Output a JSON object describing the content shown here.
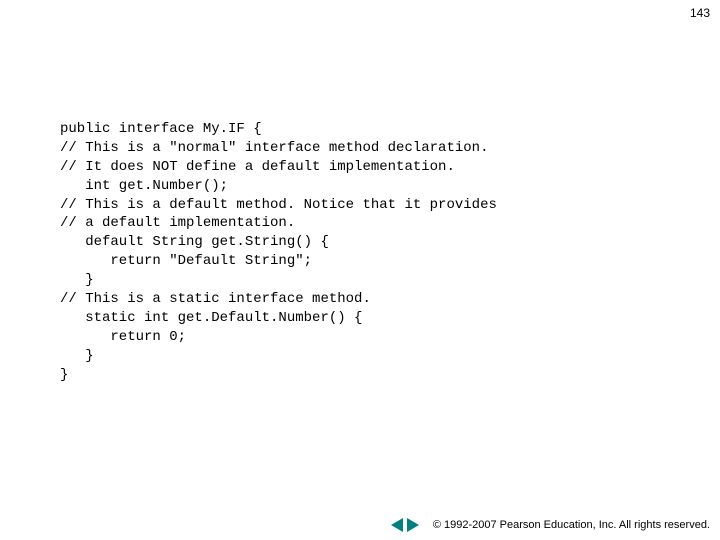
{
  "page_number": "143",
  "code": {
    "line1": "public interface My.IF {",
    "line2": "// This is a \"normal\" interface method declaration.",
    "line3": "// It does NOT define a default implementation.",
    "line4": "   int get.Number();",
    "line5": "// This is a default method. Notice that it provides",
    "line6": "// a default implementation.",
    "line7": "   default String get.String() {",
    "line8": "      return \"Default String\";",
    "line9": "   }",
    "line10": "// This is a static interface method.",
    "line11": "   static int get.Default.Number() {",
    "line12": "      return 0;",
    "line13": "   }",
    "line14": "}"
  },
  "footer": {
    "copyright_symbol": "©",
    "copyright_text": " 1992-2007 Pearson Education, Inc.  All rights reserved."
  }
}
